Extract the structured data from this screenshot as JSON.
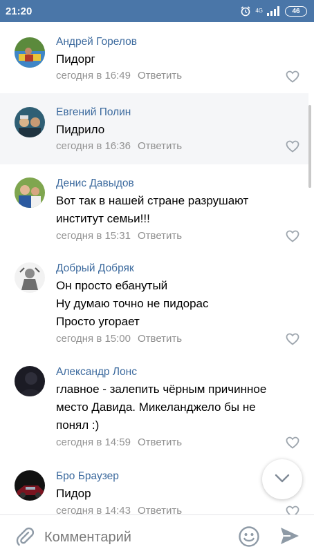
{
  "status_bar": {
    "time": "21:20",
    "alarm_icon": "alarm-clock-icon",
    "network_label": "4G",
    "signal_icon": "signal-bars-icon",
    "battery": "46"
  },
  "comments": [
    {
      "author": "Андрей Горелов",
      "lines": [
        "Пидорг"
      ],
      "time": "сегодня в 16:49",
      "reply": "Ответить",
      "highlighted": false
    },
    {
      "author": "Евгений Полин",
      "lines": [
        "Пидрило"
      ],
      "time": "сегодня в 16:36",
      "reply": "Ответить",
      "highlighted": true
    },
    {
      "author": "Денис Давыдов",
      "lines": [
        "Вот так в нашей стране разрушают",
        "институт семьи!!!"
      ],
      "time": "сегодня в 15:31",
      "reply": "Ответить",
      "highlighted": false
    },
    {
      "author": "Добрый Добряк",
      "lines": [
        "Он просто ебанутый",
        "Ну думаю точно не пидорас",
        "Просто угорает"
      ],
      "time": "сегодня в 15:00",
      "reply": "Ответить",
      "highlighted": false
    },
    {
      "author": "Александр Лонс",
      "lines": [
        "главное - залепить чёрным причинное",
        "место Давида. Микеланджело бы не",
        "понял :)"
      ],
      "time": "сегодня в 14:59",
      "reply": "Ответить",
      "highlighted": false
    },
    {
      "author": "Бро Браузер",
      "lines": [
        "Пидор"
      ],
      "time": "сегодня в 14:43",
      "reply": "Ответить",
      "highlighted": false
    }
  ],
  "composer": {
    "placeholder": "Комментарий",
    "attach_icon": "paperclip-icon",
    "emoji_icon": "smiley-icon",
    "send_icon": "send-icon"
  },
  "scroll_button_icon": "chevron-down-icon",
  "colors": {
    "status_bar": "#4a76a8",
    "author_link": "#3c6a9e",
    "meta_text": "#939393",
    "highlight_row": "#f5f6f8"
  }
}
